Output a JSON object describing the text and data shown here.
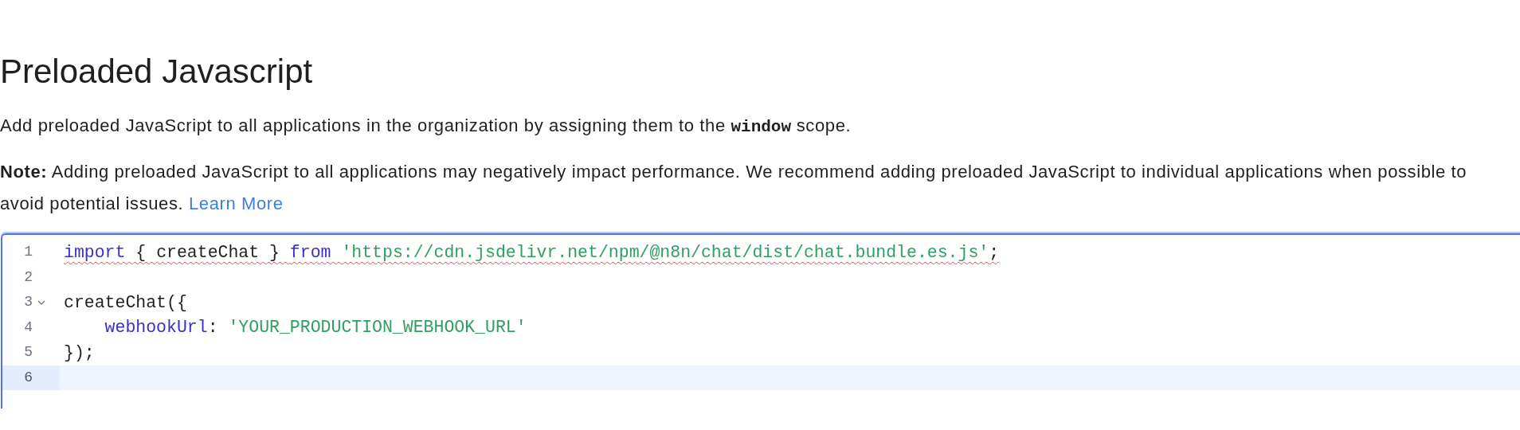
{
  "title": "Preloaded Javascript",
  "intro": [
    {
      "kind": "text",
      "text": "Add preloaded JavaScript to all applications in the organization by assigning them to the "
    },
    {
      "kind": "code",
      "text": "window"
    },
    {
      "kind": "text",
      "text": " scope."
    }
  ],
  "note": {
    "text": "**Note:** Adding preloaded JavaScript to all applications may negatively impact performance. We recommend adding preloaded JavaScript to individual applications when possible to avoid potential issues.",
    "link": "Learn More"
  },
  "editor": {
    "lines": [
      {
        "number": "1",
        "active": false,
        "error": true,
        "foldable": false,
        "tokens": [
          {
            "kind": "keyword",
            "text": "import"
          },
          {
            "kind": "plain",
            "text": " { createChat } "
          },
          {
            "kind": "keyword",
            "text": "from "
          },
          {
            "kind": "string",
            "text": "'https://cdn.jsdelivr.net/npm/@n8n/chat/dist/chat.bundle.es.js'"
          },
          {
            "kind": "plain",
            "text": ";"
          }
        ]
      },
      {
        "number": "2",
        "active": false,
        "error": false,
        "foldable": false
      },
      {
        "number": "3",
        "active": false,
        "error": false,
        "foldable": true,
        "tokens": [
          {
            "kind": "plain",
            "text": "createChat({"
          }
        ]
      },
      {
        "number": "4",
        "active": false,
        "error": false,
        "foldable": false,
        "tokens": [
          {
            "kind": "property",
            "text": "    webhookUrl"
          },
          {
            "kind": "plain",
            "text": ": "
          },
          {
            "kind": "string",
            "text": "'YOUR_PRODUCTION_WEBHOOK_URL'"
          }
        ]
      },
      {
        "number": "5",
        "active": false,
        "error": false,
        "foldable": false,
        "tokens": [
          {
            "kind": "plain",
            "text": "});"
          }
        ]
      },
      {
        "number": "6",
        "active": true,
        "error": false,
        "foldable": false
      }
    ]
  }
}
